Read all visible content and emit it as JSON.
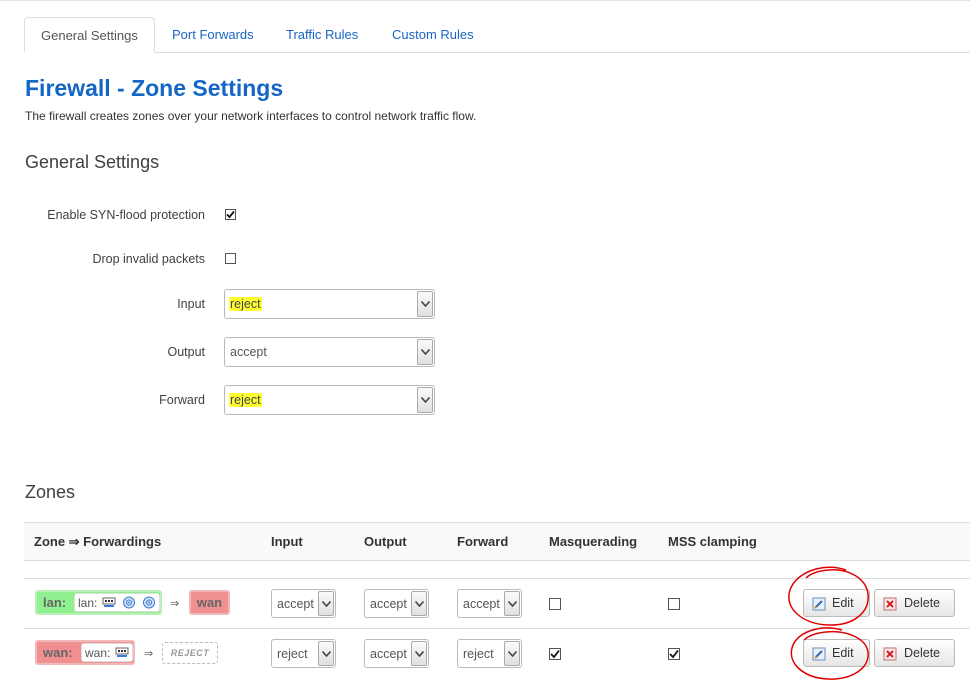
{
  "tabs": [
    "General Settings",
    "Port Forwards",
    "Traffic Rules",
    "Custom Rules"
  ],
  "page": {
    "title": "Firewall - Zone Settings",
    "description": "The firewall creates zones over your network interfaces to control network traffic flow."
  },
  "general": {
    "heading": "General Settings",
    "syn_flood_label": "Enable SYN-flood protection",
    "syn_flood_checked": true,
    "drop_invalid_label": "Drop invalid packets",
    "drop_invalid_checked": false,
    "input_label": "Input",
    "input_value": "reject",
    "output_label": "Output",
    "output_value": "accept",
    "forward_label": "Forward",
    "forward_value": "reject"
  },
  "zones": {
    "heading": "Zones",
    "headers": {
      "zone": "Zone ⇒ Forwardings",
      "input": "Input",
      "output": "Output",
      "forward": "Forward",
      "masq": "Masquerading",
      "mss": "MSS clamping"
    },
    "rows": [
      {
        "zone": "lan:",
        "iface_label": "lan:",
        "arrow": "⇒",
        "target": "wan",
        "input": "accept",
        "output": "accept",
        "forward": "accept",
        "masquerading": false,
        "mss_clamping": false,
        "edit": "Edit",
        "delete": "Delete"
      },
      {
        "zone": "wan:",
        "iface_label": "wan:",
        "arrow": "⇒",
        "target": "REJECT",
        "input": "reject",
        "output": "accept",
        "forward": "reject",
        "masquerading": true,
        "mss_clamping": true,
        "edit": "Edit",
        "delete": "Delete"
      }
    ]
  },
  "colors": {
    "link": "#1a66c2",
    "title": "#1466c6",
    "lan_zone": "#90f090",
    "wan_zone": "#f09090",
    "highlight": "#ffff33",
    "annotation": "#e00000"
  },
  "icons": [
    "checkmark-icon",
    "dropdown-arrow-icon",
    "ethernet-icon",
    "wifi-icon",
    "edit-icon",
    "delete-icon"
  ]
}
